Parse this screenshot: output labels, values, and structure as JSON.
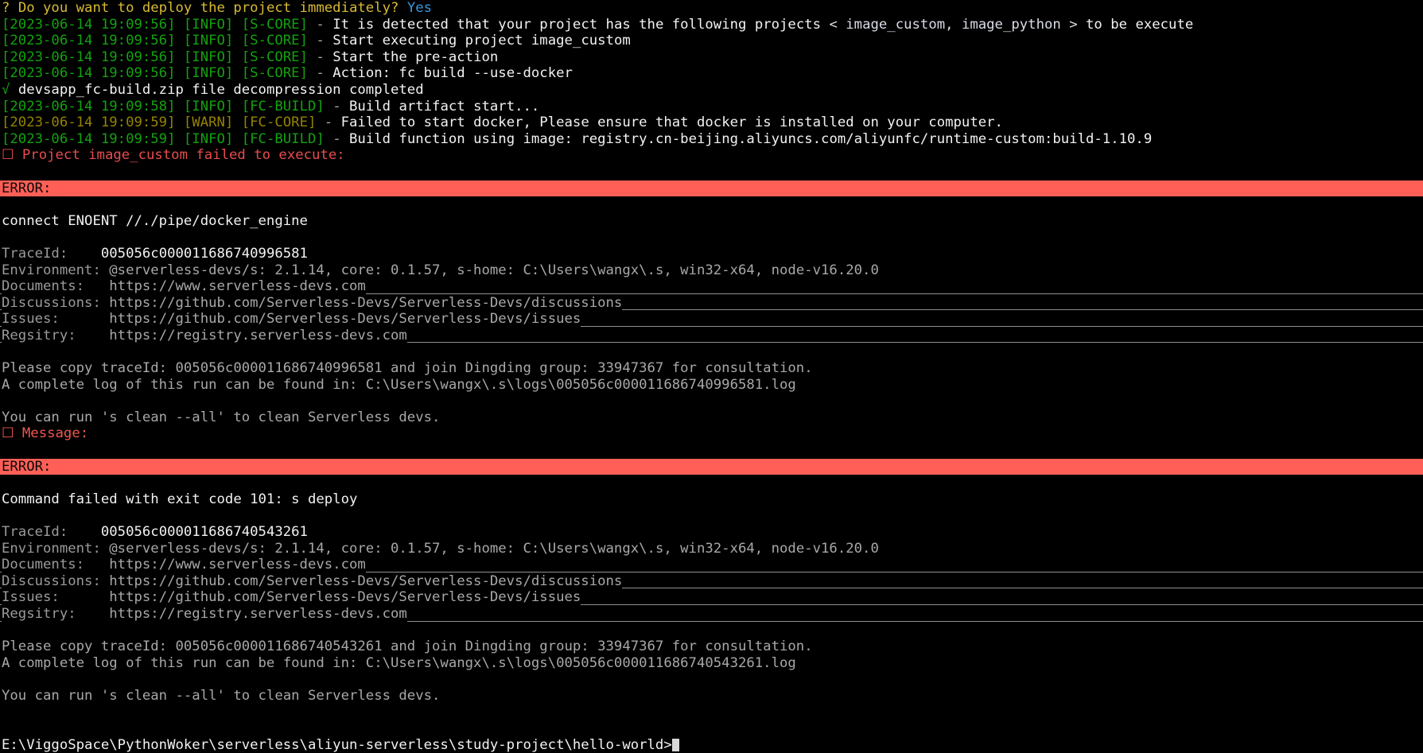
{
  "terminal": {
    "title": "Windows Command Prompt - serverless devs deploy",
    "background": "#000000",
    "error_banner_bg": "#ff5f56",
    "green": "#13a10e",
    "olive": "#948300",
    "red": "#e74c4c",
    "yellow": "#d7ba34",
    "cyan": "#3a96dd"
  },
  "prompt_question": {
    "marker": "?",
    "text": "Do you want to deploy the project immediately?",
    "answer": "Yes"
  },
  "log_lines": [
    {
      "timestamp": "[2023-06-14 19:09:56]",
      "level": "[INFO]",
      "source": "[S-CORE]",
      "dash": "-",
      "message_pre": "It is detected that your project has the following projects",
      "bracket_open": "<",
      "projects": "image_custom, image_python",
      "bracket_close": ">",
      "message_post": "to be execute",
      "tone": "info"
    },
    {
      "timestamp": "[2023-06-14 19:09:56]",
      "level": "[INFO]",
      "source": "[S-CORE]",
      "dash": "-",
      "message": "Start executing project image_custom",
      "tone": "info"
    },
    {
      "timestamp": "[2023-06-14 19:09:56]",
      "level": "[INFO]",
      "source": "[S-CORE]",
      "dash": "-",
      "message": "Start the pre-action",
      "tone": "info"
    },
    {
      "timestamp": "[2023-06-14 19:09:56]",
      "level": "[INFO]",
      "source": "[S-CORE]",
      "dash": "-",
      "message": "Action: fc build --use-docker",
      "tone": "info"
    },
    {
      "timestamp": "[2023-06-14 19:09:58]",
      "level": "[INFO]",
      "source": "[FC-BUILD]",
      "dash": "-",
      "message": "Build artifact start...",
      "tone": "info"
    },
    {
      "timestamp": "[2023-06-14 19:09:59]",
      "level": "[WARN]",
      "source": "[FC-CORE]",
      "dash": "-",
      "message": "Failed to start docker, Please ensure that docker is installed on your computer.",
      "tone": "warn"
    },
    {
      "timestamp": "[2023-06-14 19:09:59]",
      "level": "[INFO]",
      "source": "[FC-BUILD]",
      "dash": "-",
      "message": "Build function using image: registry.cn-beijing.aliyuncs.com/aliyunfc/runtime-custom:build-1.10.9",
      "tone": "info"
    }
  ],
  "decompression_line": {
    "check": "√",
    "text": "devsapp_fc-build.zip file decompression completed"
  },
  "project_failed_line": {
    "box": "☐",
    "text": "Project image_custom failed to execute:"
  },
  "error_block_1": {
    "banner": "ERROR:",
    "summary": "connect ENOENT //./pipe/docker_engine",
    "fields": [
      {
        "label": "TraceId:",
        "pad": "    ",
        "value": "005056c000011686740996581",
        "is_link": false
      },
      {
        "label": "Environment:",
        "pad": " ",
        "value": "@serverless-devs/s: 2.1.14, core: 0.1.57, s-home: C:\\Users\\wangx\\.s, win32-x64, node-v16.20.0",
        "is_link": false
      },
      {
        "label": "Documents:",
        "pad": "   ",
        "value": "https://www.serverless-devs.com",
        "is_link": true
      },
      {
        "label": "Discussions:",
        "pad": " ",
        "value": "https://github.com/Serverless-Devs/Serverless-Devs/discussions",
        "is_link": true
      },
      {
        "label": "Issues:",
        "pad": "      ",
        "value": "https://github.com/Serverless-Devs/Serverless-Devs/issues",
        "is_link": true
      },
      {
        "label": "Regsitry:",
        "pad": "    ",
        "value": "https://registry.serverless-devs.com",
        "is_link": true
      }
    ],
    "trace_hint": "Please copy traceId: 005056c000011686740996581 and join Dingding group: 33947367 for consultation.",
    "log_hint": "A complete log of this run can be found in: C:\\Users\\wangx\\.s\\logs\\005056c000011686740996581.log",
    "clean_hint": "You can run 's clean --all' to clean Serverless devs."
  },
  "message_line": {
    "box": "☐",
    "text": "Message:"
  },
  "error_block_2": {
    "banner": "ERROR:",
    "summary": "Command failed with exit code 101: s deploy",
    "fields": [
      {
        "label": "TraceId:",
        "pad": "    ",
        "value": "005056c000011686740543261",
        "is_link": false
      },
      {
        "label": "Environment:",
        "pad": " ",
        "value": "@serverless-devs/s: 2.1.14, core: 0.1.57, s-home: C:\\Users\\wangx\\.s, win32-x64, node-v16.20.0",
        "is_link": false
      },
      {
        "label": "Documents:",
        "pad": "   ",
        "value": "https://www.serverless-devs.com",
        "is_link": true
      },
      {
        "label": "Discussions:",
        "pad": " ",
        "value": "https://github.com/Serverless-Devs/Serverless-Devs/discussions",
        "is_link": true
      },
      {
        "label": "Issues:",
        "pad": "      ",
        "value": "https://github.com/Serverless-Devs/Serverless-Devs/issues",
        "is_link": true
      },
      {
        "label": "Regsitry:",
        "pad": "    ",
        "value": "https://registry.serverless-devs.com",
        "is_link": true
      }
    ],
    "trace_hint": "Please copy traceId: 005056c000011686740543261 and join Dingding group: 33947367 for consultation.",
    "log_hint": "A complete log of this run can be found in: C:\\Users\\wangx\\.s\\logs\\005056c000011686740543261.log",
    "clean_hint": "You can run 's clean --all' to clean Serverless devs."
  },
  "shell_prompt": {
    "path": "E:\\ViggoSpace\\PythonWoker\\serverless\\aliyun-serverless\\study-project\\hello-world>",
    "cursor": "block"
  }
}
